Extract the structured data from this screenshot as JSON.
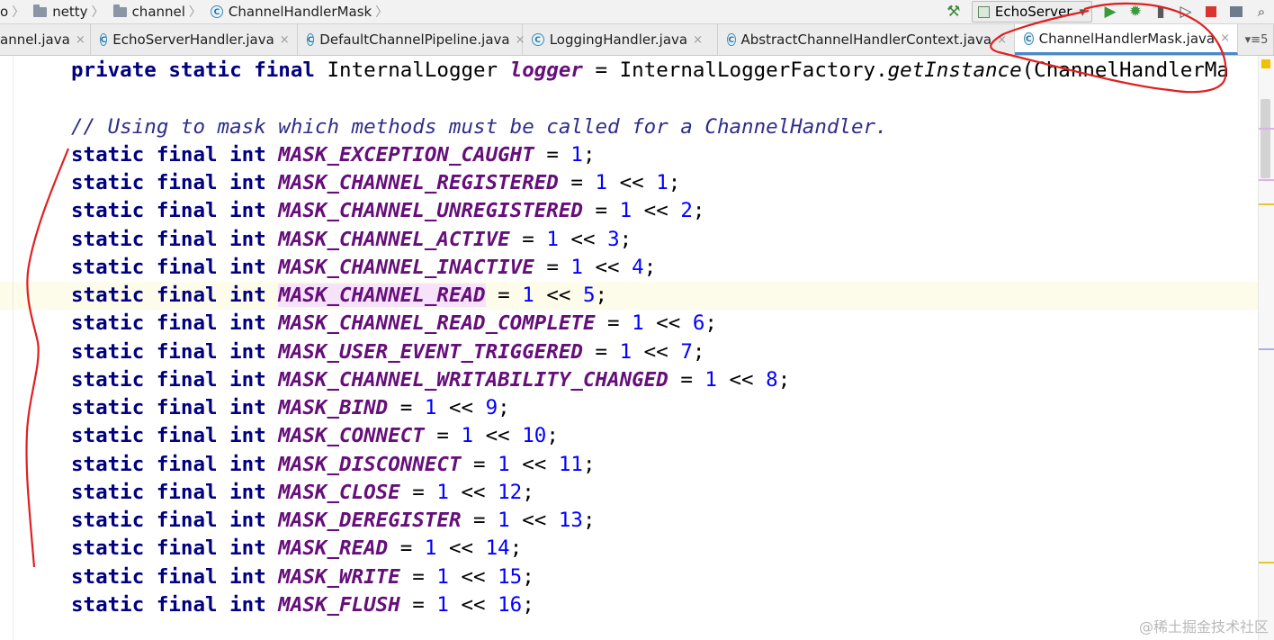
{
  "breadcrumb": {
    "items": [
      {
        "label": "o",
        "icon": ""
      },
      {
        "label": "netty",
        "icon": "folder-icon"
      },
      {
        "label": "channel",
        "icon": "folder-icon"
      },
      {
        "label": "ChannelHandlerMask",
        "icon": "class-icon"
      }
    ],
    "separator": "〉"
  },
  "toolbar": {
    "build_icon": "hammer-icon",
    "run_config": "EchoServer",
    "run_config_arrow": "▾"
  },
  "tabs": [
    {
      "label": "annel.java",
      "icon": ""
    },
    {
      "label": "EchoServerHandler.java",
      "icon": "class-icon"
    },
    {
      "label": "DefaultChannelPipeline.java",
      "icon": "class-icon"
    },
    {
      "label": "LoggingHandler.java",
      "icon": "class-icon"
    },
    {
      "label": "AbstractChannelHandlerContext.java",
      "icon": "class-icon"
    },
    {
      "label": "ChannelHandlerMask.java",
      "icon": "class-icon",
      "active": true
    }
  ],
  "tab_close": "×",
  "tab_overflow": "▾≡5",
  "class_icon_letter": "C",
  "code": {
    "line0": {
      "kw": "private static final",
      "type": " InternalLogger ",
      "name": "logger",
      "rest1": " = InternalLoggerFactory.",
      "method": "getInstance",
      "rest2": "(ChannelHandlerMa"
    },
    "comment": "// Using to mask which methods must be called for a ChannelHandler.",
    "prefix": "static final int ",
    "constants": [
      {
        "name": "MASK_EXCEPTION_CAUGHT",
        "value": "1",
        "shift": ""
      },
      {
        "name": "MASK_CHANNEL_REGISTERED",
        "value": "1",
        "shift": "1"
      },
      {
        "name": "MASK_CHANNEL_UNREGISTERED",
        "value": "1",
        "shift": "2"
      },
      {
        "name": "MASK_CHANNEL_ACTIVE",
        "value": "1",
        "shift": "3"
      },
      {
        "name": "MASK_CHANNEL_INACTIVE",
        "value": "1",
        "shift": "4"
      },
      {
        "name": "MASK_CHANNEL_READ",
        "value": "1",
        "shift": "5"
      },
      {
        "name": "MASK_CHANNEL_READ_COMPLETE",
        "value": "1",
        "shift": "6"
      },
      {
        "name": "MASK_USER_EVENT_TRIGGERED",
        "value": "1",
        "shift": "7"
      },
      {
        "name": "MASK_CHANNEL_WRITABILITY_CHANGED",
        "value": "1",
        "shift": "8"
      },
      {
        "name": "MASK_BIND",
        "value": "1",
        "shift": "9"
      },
      {
        "name": "MASK_CONNECT",
        "value": "1",
        "shift": "10"
      },
      {
        "name": "MASK_DISCONNECT",
        "value": "1",
        "shift": "11"
      },
      {
        "name": "MASK_CLOSE",
        "value": "1",
        "shift": "12"
      },
      {
        "name": "MASK_DEREGISTER",
        "value": "1",
        "shift": "13"
      },
      {
        "name": "MASK_READ",
        "value": "1",
        "shift": "14"
      },
      {
        "name": "MASK_WRITE",
        "value": "1",
        "shift": "15"
      },
      {
        "name": "MASK_FLUSH",
        "value": "1",
        "shift": "16"
      }
    ]
  },
  "watermark": "@稀土掘金技术社区",
  "colors": {
    "keyword": "#000080",
    "constant": "#660e7a",
    "number": "#0000ff",
    "annotation_pen": "#e02020",
    "caret_row": "#fdfbe9"
  }
}
